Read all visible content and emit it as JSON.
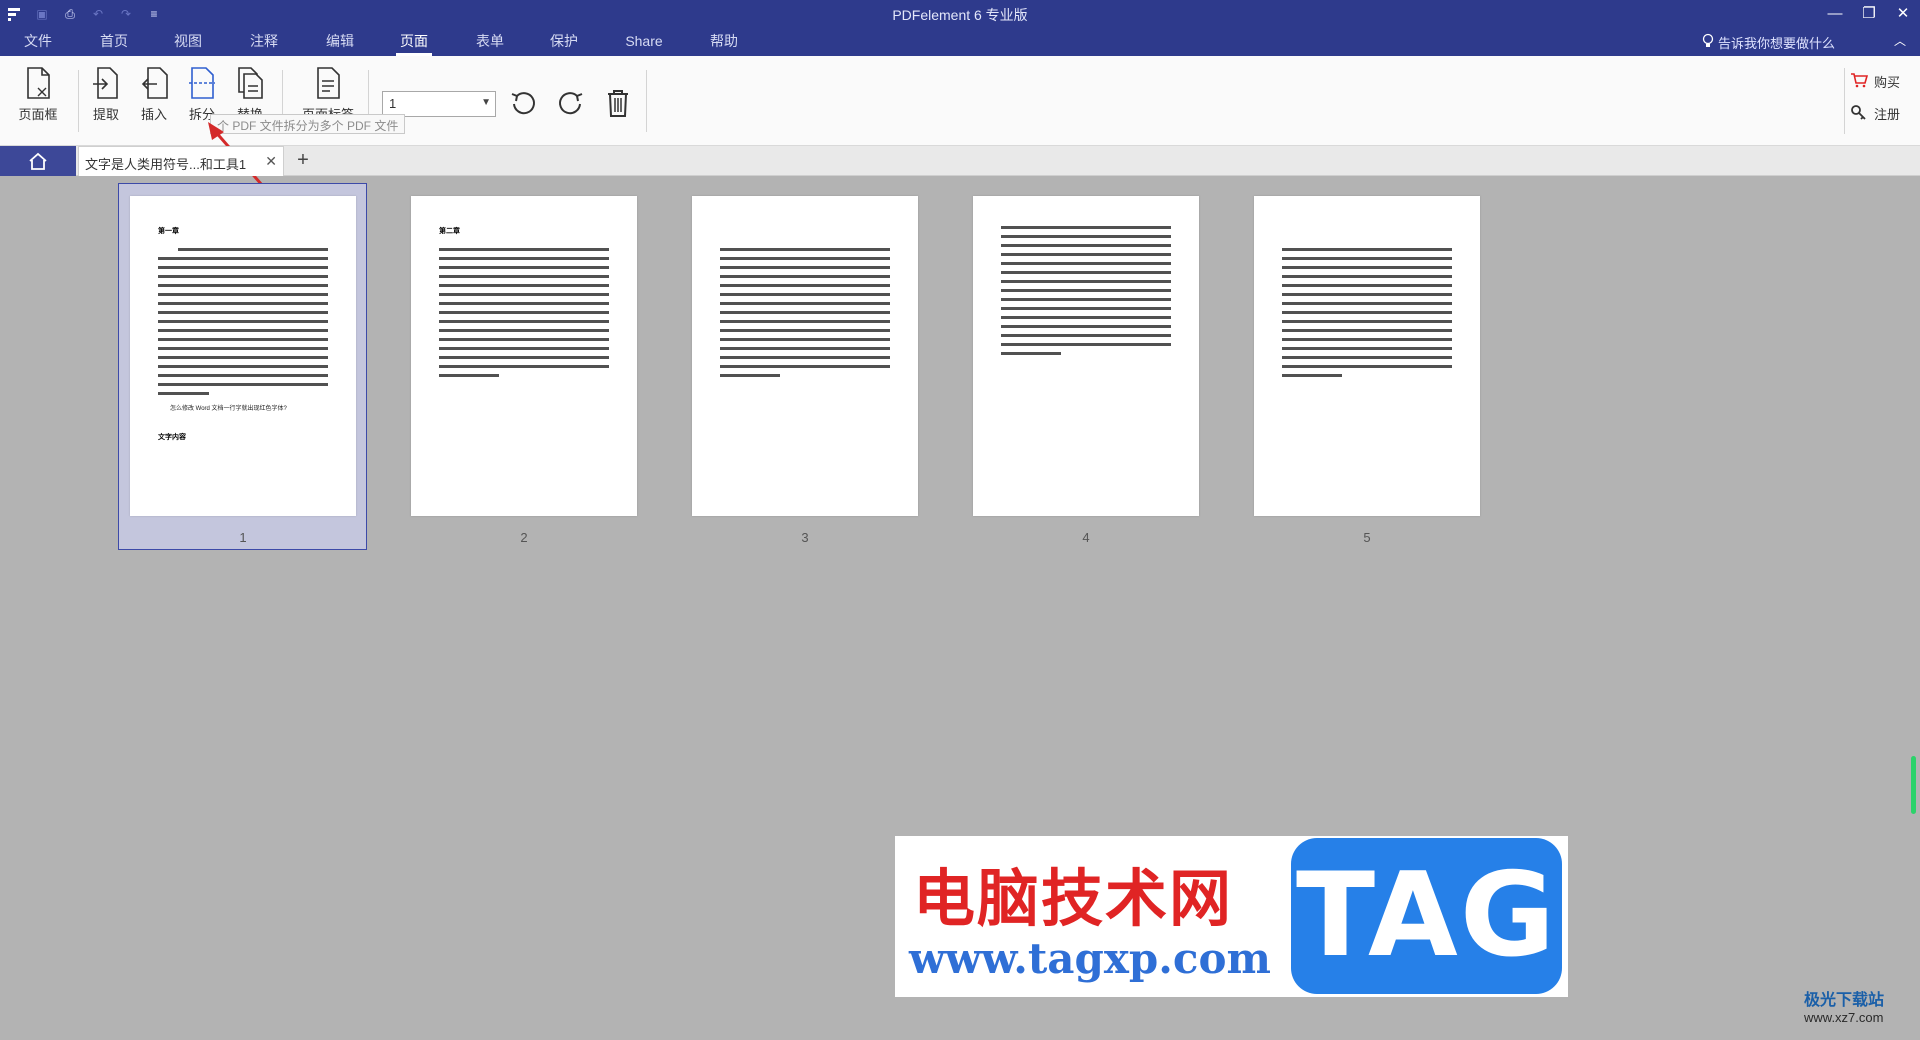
{
  "window": {
    "title": "PDFelement  6 专业版"
  },
  "menu": {
    "tabs": [
      "文件",
      "首页",
      "视图",
      "注释",
      "编辑",
      "页面",
      "表单",
      "保护",
      "Share",
      "帮助"
    ],
    "active": "页面",
    "tell_me": "告诉我你想要做什么"
  },
  "toolbar": {
    "page_box": "页面框",
    "extract": "提取",
    "insert": "插入",
    "split": "拆分",
    "replace": "替换",
    "page_label": "页面标签",
    "page_select_value": "1",
    "tooltip": "个 PDF 文件拆分为多个 PDF 文件",
    "buy": "购买",
    "register": "注册"
  },
  "doc_tab": {
    "title": "文字是人类用符号...和工具1"
  },
  "pages": [
    {
      "number": "1",
      "heading": "第一章",
      "note": "怎么修改 Word 文档一行字就出现红色字体?",
      "footer_heading": "文字内容"
    },
    {
      "number": "2",
      "heading": "第二章"
    },
    {
      "number": "3"
    },
    {
      "number": "4"
    },
    {
      "number": "5"
    }
  ],
  "watermark": {
    "site_name": "电脑技术网",
    "url": "www.tagxp.com",
    "tag": "TAG",
    "corner_name": "极光下载站",
    "corner_url": "www.xz7.com"
  },
  "colors": {
    "accent": "#2e3a8c",
    "selection": "#3d4aa8"
  }
}
